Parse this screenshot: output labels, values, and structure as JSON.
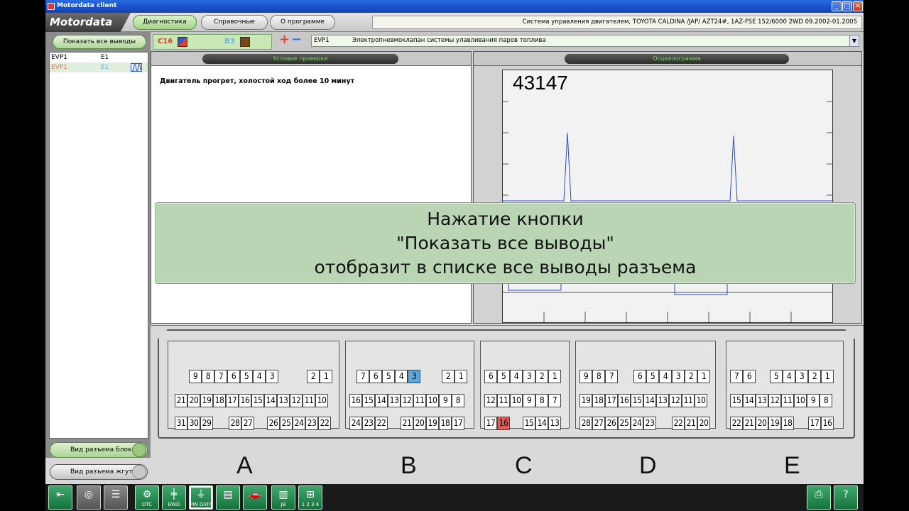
{
  "window": {
    "title": "Motordata client"
  },
  "menu": {
    "logo": "Motordata",
    "tabs": [
      {
        "label": "Диагностика"
      },
      {
        "label": "Справочные данные"
      },
      {
        "label": "О программе"
      }
    ],
    "vehicle_info": "Система управления двигателем, TOYOTA  CALDINA /JAP/  AZT24#,    1AZ-FSE  152/6000  2WD  09.2002-01.2005"
  },
  "left": {
    "show_all_label": "Показать все выводы",
    "pins": [
      {
        "name": "EVP1",
        "ground": "E1"
      },
      {
        "name": "EVP1",
        "ground": "E1"
      }
    ],
    "connector_view_label": "Вид разъема блока",
    "harness_view_label": "Вид разъема жгута"
  },
  "channels": {
    "ch1": "C16",
    "ch2": "B3",
    "ch1_color": "#2b57d6",
    "ch2_color": "#7a4616",
    "plus": "+",
    "minus": "−",
    "signal_code": "EVP1",
    "signal_desc": "Электропневмоклапан системы улавливания паров топлива"
  },
  "condition": {
    "header": "Условие проверки",
    "text": "Двигатель прогрет, холостой ход более 10 минут"
  },
  "oscillogram": {
    "header": "Осциллограмма",
    "value": "43147"
  },
  "tooltip": {
    "line1": "Нажатие кнопки",
    "line2": "\"Показать все выводы\"",
    "line3": "отобразит в списке все выводы разъема"
  },
  "connectors": {
    "letters": [
      "A",
      "B",
      "C",
      "D",
      "E"
    ],
    "highlight_blue": "B3",
    "highlight_red": "C16",
    "A": {
      "row1": [
        "9",
        "8",
        "7",
        "6",
        "5",
        "4",
        "3",
        "2",
        "1"
      ],
      "row2": [
        "21",
        "20",
        "19",
        "18",
        "17",
        "16",
        "15",
        "14",
        "13",
        "12",
        "11",
        "10"
      ],
      "row3": [
        "31",
        "30",
        "29",
        "28",
        "27",
        "26",
        "25",
        "24",
        "23",
        "22"
      ]
    },
    "B": {
      "row1": [
        "7",
        "6",
        "5",
        "4",
        "3",
        "2",
        "1"
      ],
      "row2": [
        "16",
        "15",
        "14",
        "13",
        "12",
        "11",
        "10",
        "9",
        "8"
      ],
      "row3": [
        "24",
        "23",
        "22",
        "21",
        "20",
        "19",
        "18",
        "17"
      ]
    },
    "C": {
      "row1": [
        "6",
        "5",
        "4",
        "3",
        "2",
        "1"
      ],
      "row2": [
        "12",
        "11",
        "10",
        "9",
        "8",
        "7"
      ],
      "row3": [
        "17",
        "16",
        "15",
        "14",
        "13"
      ]
    },
    "D": {
      "row1": [
        "9",
        "8",
        "7",
        "6",
        "5",
        "4",
        "3",
        "2",
        "1"
      ],
      "row2": [
        "19",
        "18",
        "17",
        "16",
        "15",
        "14",
        "13",
        "12",
        "11",
        "10"
      ],
      "row3": [
        "28",
        "27",
        "26",
        "25",
        "24",
        "23",
        "22",
        "21",
        "20"
      ]
    },
    "E": {
      "row1": [
        "7",
        "6",
        "5",
        "4",
        "3",
        "2",
        "1"
      ],
      "row2": [
        "15",
        "14",
        "13",
        "12",
        "11",
        "10",
        "9",
        "8"
      ],
      "row3": [
        "22",
        "21",
        "20",
        "19",
        "18",
        "17",
        "16"
      ]
    }
  },
  "toolbar": {
    "buttons": [
      {
        "label": "",
        "icon": "exit-icon"
      },
      {
        "label": "",
        "icon": "search-icon"
      },
      {
        "label": "",
        "icon": "list-icon"
      },
      {
        "label": "DTC",
        "icon": "dtc-icon"
      },
      {
        "label": "EWD",
        "icon": "ewd-icon"
      },
      {
        "label": "PIN DATA",
        "icon": "pin-data-icon"
      },
      {
        "label": "",
        "icon": "tester-icon"
      },
      {
        "label": "",
        "icon": "vehicle-icon"
      },
      {
        "label": "JB",
        "icon": "junction-block-icon"
      },
      {
        "label": "1 2 3 4",
        "icon": "pinout-icon"
      },
      {
        "label": "",
        "icon": "print-icon"
      },
      {
        "label": "",
        "icon": "help-icon"
      }
    ]
  }
}
